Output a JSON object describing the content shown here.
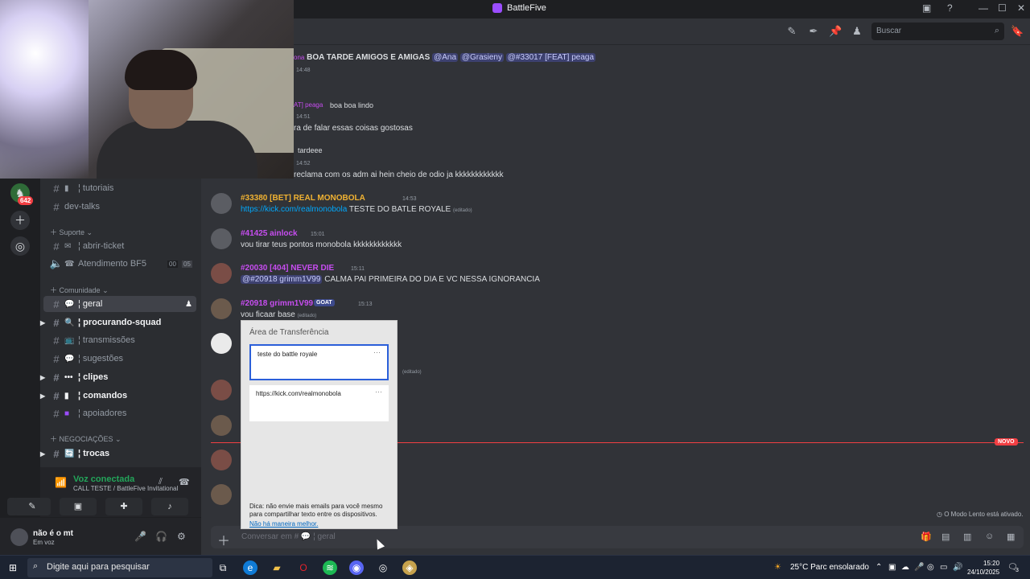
{
  "window": {
    "title": "BattleFive",
    "controls": [
      "—",
      "☐",
      "✕"
    ]
  },
  "header": {
    "search_placeholder": "Buscar"
  },
  "guilds": {
    "badge": "642"
  },
  "channels": {
    "items": [
      {
        "emoji": "▮",
        "label": "¦ tutoriais"
      },
      {
        "label": "dev-talks"
      },
      {
        "category": "Suporte"
      },
      {
        "emoji": "✉",
        "label": "¦ abrir-ticket"
      },
      {
        "emoji": "☎",
        "label": "Atendimento BF5",
        "counts": [
          "00",
          "05"
        ]
      },
      {
        "category": "Comunidade"
      },
      {
        "emoji": "💬",
        "label": "¦ geral"
      },
      {
        "emoji": "🔍",
        "label": "¦ procurando-squad"
      },
      {
        "emoji": "📺",
        "label": "¦ transmissões"
      },
      {
        "emoji": "💬",
        "label": "¦ sugestões"
      },
      {
        "emoji": "•••",
        "label": "¦ clipes"
      },
      {
        "emoji": "▮",
        "label": "¦ comandos"
      },
      {
        "emoji": "■",
        "label": "¦ apoiadores"
      },
      {
        "category": "NEGOCIAÇÕES"
      },
      {
        "emoji": "🔄",
        "label": "¦ trocas"
      }
    ]
  },
  "voice": {
    "status": "Voz conectada",
    "channel": "CALL TESTE / BattleFive Invitational"
  },
  "user": {
    "name": "não é o mt",
    "status": "Em voz"
  },
  "messages": [
    {
      "text": "BOA TARDE AMIGOS E AMIGAS",
      "mentions": [
        "@Ana",
        "@Grasieny",
        "@#33017 [FEAT] peaga"
      ],
      "prefix": "ona"
    },
    {
      "time": "14:48"
    },
    {
      "name": "AT] peaga",
      "text": "boa boa lindo"
    },
    {
      "time": "14:51",
      "text": "ra de falar essas coisas gostosas"
    },
    {
      "text": "tardeee"
    },
    {
      "time": "14:52",
      "text": "reclama com os adm ai hein cheio de odio ja kkkkkkkkkkkk"
    },
    {
      "name": "#33380 [BET] REAL MONOBOLA",
      "time": "14:53",
      "link": "https://kick.com/realmonobola",
      "text": "TESTE DO BATLE ROYALE",
      "edited": "(editado)"
    },
    {
      "name": "#41425 ainlock",
      "time": "15:01",
      "text": "vou tirar teus pontos monobola kkkkkkkkkkkk"
    },
    {
      "name": "#20030 [404] NEVER DIE",
      "time": "15:11",
      "mention": "@#20918 grimm1V99",
      "text": "CALMA PAI PRIMEIRA DO DIA E VC NESSA IGNORANCIA"
    },
    {
      "name": "#20918 grimm1V99",
      "tag": "GOAT",
      "time": "15:13",
      "text": "vou ficaar base",
      "edited": "(editado)"
    },
    {
      "edited": "(editado)"
    }
  ],
  "new_label": "NOVO",
  "slowmode": "O Modo Lento está ativado.",
  "composer": {
    "placeholder": "Conversar em #",
    "channel": "¦ geral"
  },
  "clipboard": {
    "title": "Área de Transferência",
    "items": [
      "teste do battle royale",
      "https://kick.com/realmonobola"
    ],
    "item_menu": "···",
    "tip": "Dica: não envie mais emails para você mesmo para compartilhar texto entre os dispositivos.",
    "tip_link": "Não há maneira melhor."
  },
  "taskbar": {
    "search": "Digite aqui para pesquisar",
    "weather": "25°C  Parc ensolarado",
    "time": "15:20",
    "date": "24/10/2025",
    "notifications": "3"
  }
}
